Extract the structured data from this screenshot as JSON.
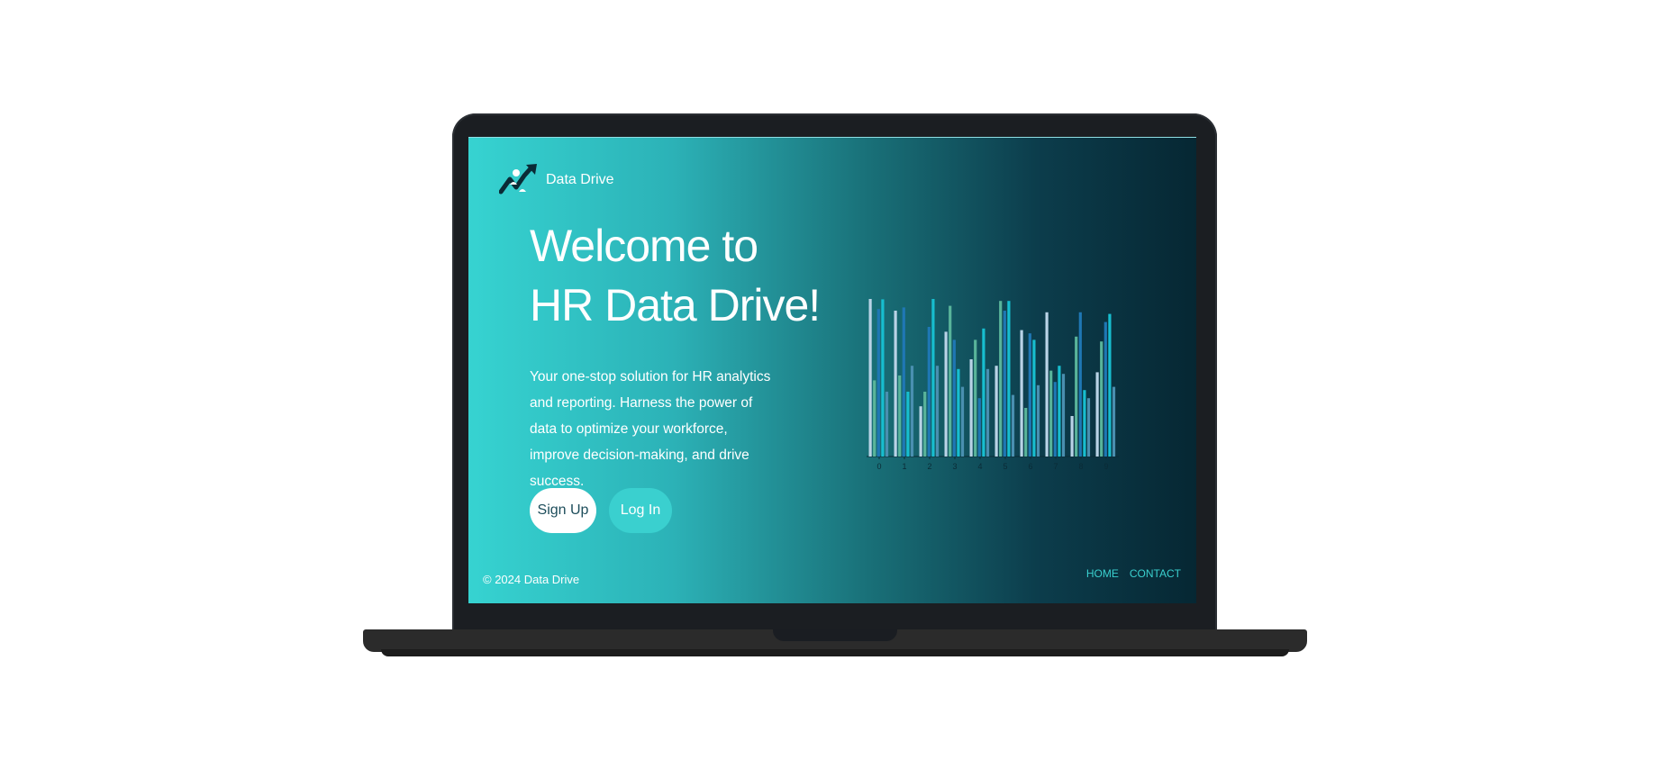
{
  "app": {
    "brand": "Data Drive"
  },
  "hero": {
    "title_line1": "Welcome to",
    "title_line2": "HR Data Drive!",
    "description": "Your one-stop solution for HR analytics and reporting. Harness the power of data to optimize your workforce, improve decision-making, and drive success."
  },
  "buttons": {
    "signup": "Sign Up",
    "login": "Log In"
  },
  "footer": {
    "copyright": "© 2024 Data Drive",
    "nav": [
      "HOME",
      "CONTACT"
    ]
  },
  "colors": {
    "screen_gradient_start": "#36d3d1",
    "screen_gradient_end": "#062733",
    "accent": "#3ad0cf"
  },
  "chart_data": {
    "type": "bar",
    "categories": [
      "0",
      "1",
      "2",
      "3",
      "4",
      "5",
      "6",
      "7",
      "8",
      "9"
    ],
    "series": [
      {
        "color": "#b9d3e6",
        "values": [
          0.99,
          0.9,
          0.31,
          0.77,
          0.6,
          0.56,
          0.78,
          0.89,
          0.25,
          0.52
        ]
      },
      {
        "color": "#59b49a",
        "values": [
          0.47,
          0.5,
          0.4,
          0.93,
          0.72,
          0.96,
          0.3,
          0.53,
          0.74,
          0.71
        ]
      },
      {
        "color": "#1f77b4",
        "values": [
          0.91,
          0.92,
          0.8,
          0.72,
          0.36,
          0.9,
          0.76,
          0.46,
          0.89,
          0.83
        ]
      },
      {
        "color": "#17becf",
        "values": [
          0.97,
          0.4,
          0.99,
          0.54,
          0.79,
          0.96,
          0.72,
          0.56,
          0.41,
          0.88
        ]
      },
      {
        "color": "#4a8fb0",
        "values": [
          0.4,
          0.56,
          0.56,
          0.43,
          0.54,
          0.38,
          0.44,
          0.51,
          0.36,
          0.43
        ]
      }
    ],
    "ylim": [
      0,
      1
    ],
    "grid": false,
    "legend": false
  }
}
